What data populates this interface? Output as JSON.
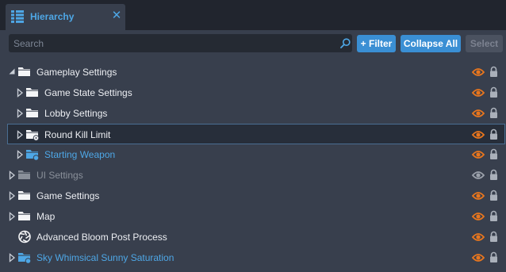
{
  "tab": {
    "title": "Hierarchy",
    "icon": "hierarchy-icon",
    "close_icon": "close-icon"
  },
  "toolbar": {
    "search_placeholder": "Search",
    "filter_label": "+ Filter",
    "collapse_label": "Collapse All",
    "select_label": "Select"
  },
  "colors": {
    "panel_bg": "#383f4d",
    "tabbar_bg": "#21252e",
    "accent_blue": "#3a8fd4",
    "template_text": "#4ea7e6",
    "eye_orange": "#e8761e",
    "disabled_text": "#8a909a",
    "selection_border": "#4a6e92"
  },
  "tree": {
    "items": [
      {
        "label": "Gameplay Settings",
        "depth": 0,
        "state": "expanded",
        "icon": "folder-icon",
        "style": "normal",
        "visible": true
      },
      {
        "label": "Game State Settings",
        "depth": 1,
        "state": "collapsed",
        "icon": "folder-icon",
        "style": "normal",
        "visible": true
      },
      {
        "label": "Lobby Settings",
        "depth": 1,
        "state": "collapsed",
        "icon": "folder-icon",
        "style": "normal",
        "visible": true
      },
      {
        "label": "Round Kill Limit",
        "depth": 1,
        "state": "collapsed",
        "icon": "folder-network-icon",
        "style": "selected",
        "visible": true
      },
      {
        "label": "Starting Weapon",
        "depth": 1,
        "state": "collapsed",
        "icon": "template-folder-icon",
        "style": "template",
        "visible": true
      },
      {
        "label": "UI Settings",
        "depth": 0,
        "state": "collapsed",
        "icon": "folder-icon",
        "style": "disabled",
        "visible": false
      },
      {
        "label": "Game Settings",
        "depth": 0,
        "state": "collapsed",
        "icon": "folder-icon",
        "style": "normal",
        "visible": true
      },
      {
        "label": "Map",
        "depth": 0,
        "state": "collapsed",
        "icon": "folder-icon",
        "style": "normal",
        "visible": true
      },
      {
        "label": "Advanced Bloom Post Process",
        "depth": 0,
        "state": "none",
        "icon": "aperture-icon",
        "style": "normal",
        "visible": true
      },
      {
        "label": "Sky Whimsical Sunny Saturation",
        "depth": 0,
        "state": "collapsed",
        "icon": "template-folder-icon",
        "style": "template",
        "visible": true
      }
    ]
  }
}
